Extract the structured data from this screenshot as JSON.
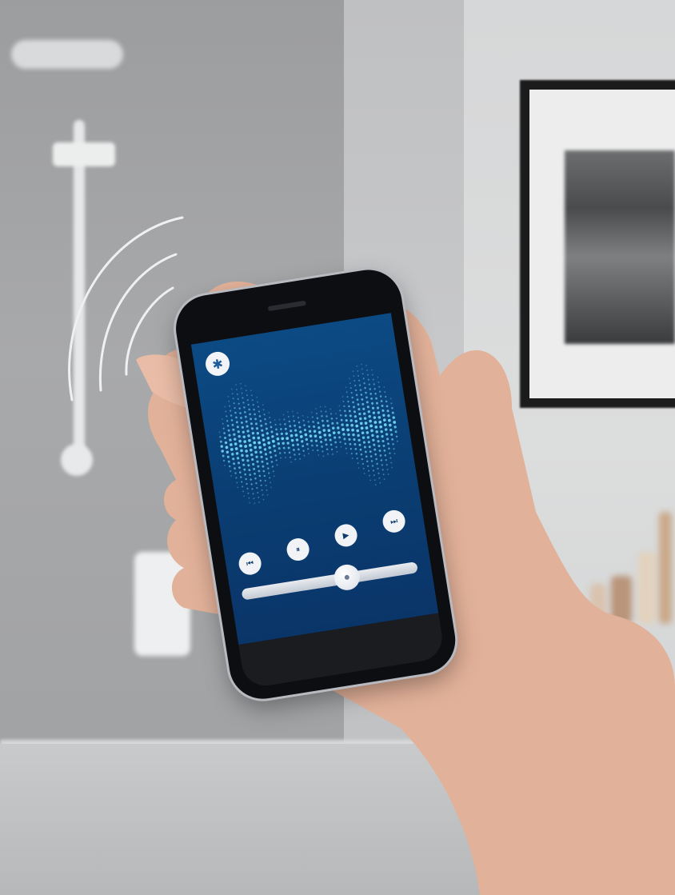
{
  "scene": {
    "description_none": "",
    "colors": {
      "wall_dark": "#9c9d9f",
      "wall_light": "#d6d7d8",
      "screen_blue": "#0c4a84",
      "waveform": "#6fd3f0",
      "controls": "#f1f3f6",
      "skin": "#e7b7a0"
    }
  },
  "app": {
    "bluetooth_icon": "bluetooth-icon",
    "controls": {
      "previous_icon": "skip-previous-icon",
      "pause_icon": "pause-icon",
      "play_icon": "play-icon",
      "next_icon": "skip-next-icon",
      "previous_glyph": "⏮",
      "pause_glyph": "⏸",
      "play_glyph": "▶",
      "next_glyph": "⏭",
      "bluetooth_glyph": "✱"
    },
    "volume_level": 0.6
  }
}
